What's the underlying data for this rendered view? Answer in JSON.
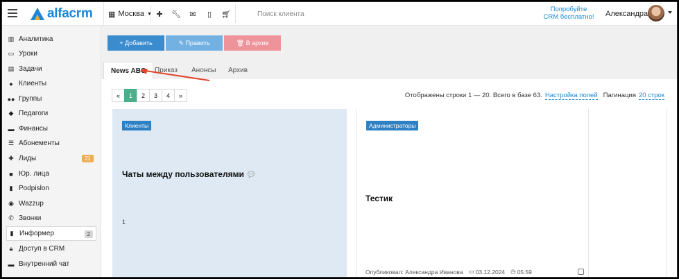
{
  "topbar": {
    "logo": "alfacrm",
    "city": "Москва",
    "search_placeholder": "Поиск клиента",
    "try_line1": "Попробуйте",
    "try_line2": "CRM бесплатно!",
    "user_name": "Александра"
  },
  "sidebar": {
    "items": [
      {
        "label": "Аналитика",
        "icon": "chart-icon"
      },
      {
        "label": "Уроки",
        "icon": "calendar-icon"
      },
      {
        "label": "Задачи",
        "icon": "clipboard-icon"
      },
      {
        "label": "Клиенты",
        "icon": "user-icon"
      },
      {
        "label": "Группы",
        "icon": "group-icon"
      },
      {
        "label": "Педагоги",
        "icon": "graduation-icon"
      },
      {
        "label": "Финансы",
        "icon": "money-icon"
      },
      {
        "label": "Абонементы",
        "icon": "subscription-icon"
      },
      {
        "label": "Лиды",
        "icon": "add-user-icon",
        "badge": "21"
      },
      {
        "label": "Юр. лица",
        "icon": "briefcase-icon"
      },
      {
        "label": "Podpislon",
        "icon": "document-icon"
      },
      {
        "label": "Wazzup",
        "icon": "whatsapp-icon"
      },
      {
        "label": "Звонки",
        "icon": "phone-icon"
      },
      {
        "label": "Информер",
        "icon": "book-icon",
        "badge": "2"
      },
      {
        "label": "Доступ в CRM",
        "icon": "lock-icon"
      },
      {
        "label": "Внутренний чат",
        "icon": "chat-icon"
      }
    ]
  },
  "actions": {
    "add": "+ Добавить",
    "edit": "✎ Править",
    "archive": "🗑 В архив"
  },
  "tabs": [
    "News ABC",
    "Приказ",
    "Анонсы",
    "Архив"
  ],
  "pagination": {
    "prev": "«",
    "pages": [
      "1",
      "2",
      "3",
      "4"
    ],
    "next": "»"
  },
  "rows_info": {
    "text": "Отображены строки 1 — 20. Всего в базе 63.",
    "fields_link": "Настройка полей",
    "pagination_label": "Пагинация",
    "pagination_link": "20 строк"
  },
  "cards": [
    {
      "tag": "Клиенты",
      "title": "Чаты между пользователями",
      "number": "1"
    },
    {
      "tag": "Администраторы",
      "title": "Тестик",
      "meta_author": "Опубликовал: Александра Иванова",
      "meta_date": "03.12.2024",
      "meta_time": "05:59"
    }
  ],
  "colors": {
    "brand": "#1a88d6",
    "add": "#3a8ccf",
    "edit": "#74b1e3",
    "archive": "#ef939b",
    "page_active": "#4cae8a",
    "arrow": "#e0442b"
  }
}
